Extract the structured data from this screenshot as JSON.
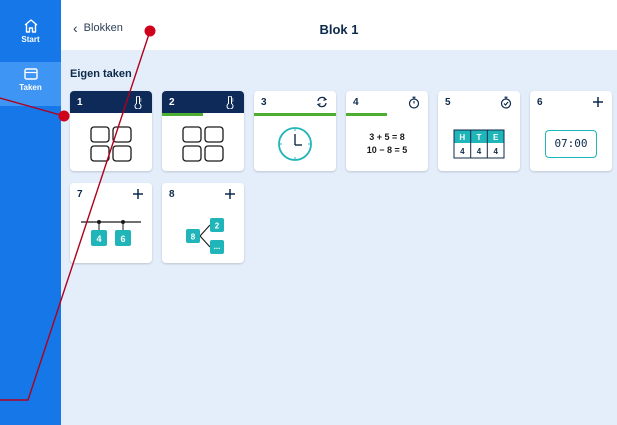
{
  "sidebar": {
    "items": [
      {
        "label": "Start",
        "icon": "home-icon",
        "active": false
      },
      {
        "label": "Taken",
        "icon": "tasks-icon",
        "active": true
      }
    ],
    "color": "#1677e8"
  },
  "header": {
    "back_label": "Blokken",
    "title": "Blok 1"
  },
  "section": {
    "title": "Eigen taken"
  },
  "cards": [
    {
      "number": "1",
      "action_icon": "thermometer-icon",
      "style": "dark",
      "progress": 0,
      "content": "four-boxes"
    },
    {
      "number": "2",
      "action_icon": "thermometer-icon",
      "style": "dark",
      "progress": 0.5,
      "content": "four-boxes"
    },
    {
      "number": "3",
      "action_icon": "refresh-icon",
      "style": "light",
      "progress": 1.0,
      "content": "clock"
    },
    {
      "number": "4",
      "action_icon": "stopwatch-icon",
      "style": "light",
      "progress": 0.5,
      "content": "sums",
      "lines": [
        "3 + 5 = 8",
        "10 − 8 = 5"
      ]
    },
    {
      "number": "5",
      "action_icon": "stopwatch-check-icon",
      "style": "light",
      "progress": 0,
      "content": "hte-table",
      "headers": [
        "H",
        "T",
        "E"
      ],
      "values": [
        "4",
        "4",
        "4"
      ]
    },
    {
      "number": "6",
      "action_icon": "plus-icon",
      "style": "light",
      "progress": 0,
      "content": "digital-clock",
      "time": "07:00"
    },
    {
      "number": "7",
      "action_icon": "plus-icon",
      "style": "light",
      "progress": 0,
      "content": "number-line",
      "values": [
        "4",
        "6"
      ]
    },
    {
      "number": "8",
      "action_icon": "plus-icon",
      "style": "light",
      "progress": 0,
      "content": "split-tree",
      "values": [
        "8",
        "2",
        "..."
      ]
    }
  ],
  "colors": {
    "accent_blue": "#1677e8",
    "navy": "#0e2a58",
    "teal": "#20b5b8",
    "green": "#4caf31",
    "annotation": "#d0021b"
  }
}
